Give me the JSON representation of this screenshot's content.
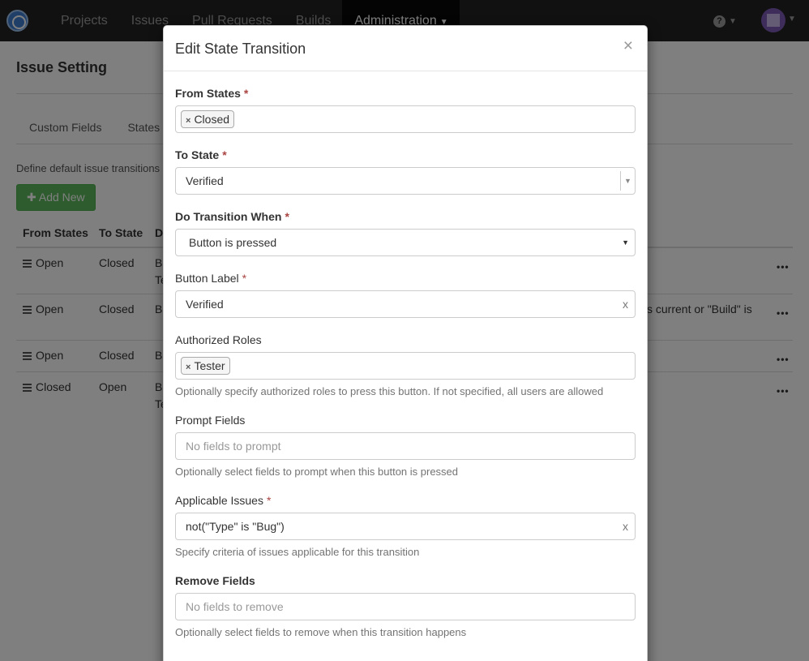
{
  "nav": {
    "items": [
      "Projects",
      "Issues",
      "Pull Requests",
      "Builds",
      "Administration"
    ],
    "active_index": 4
  },
  "page": {
    "title": "Issue Setting",
    "tabs": [
      "Custom Fields",
      "States"
    ],
    "description": "Define default issue transitions",
    "add_button": "Add New",
    "table": {
      "headers": [
        "From States",
        "To State",
        "D"
      ],
      "rows": [
        {
          "from": "Open",
          "to": "Closed",
          "desc": "Bu",
          "desc2": "Te"
        },
        {
          "from": "Open",
          "to": "Closed",
          "desc": "Bu",
          "right": "s current or \"Build\" is"
        },
        {
          "from": "Open",
          "to": "Closed",
          "desc": "Bu"
        },
        {
          "from": "Closed",
          "to": "Open",
          "desc": "Bu",
          "desc2": "Te"
        }
      ],
      "row_menu": "•••"
    }
  },
  "modal": {
    "title": "Edit State Transition",
    "close": "×",
    "from_states": {
      "label": "From States",
      "tags": [
        "Closed"
      ]
    },
    "to_state": {
      "label": "To State",
      "value": "Verified"
    },
    "do_transition_when": {
      "label": "Do Transition When",
      "value": "Button is pressed"
    },
    "button_label": {
      "label": "Button Label",
      "value": "Verified",
      "clear": "x"
    },
    "authorized_roles": {
      "label": "Authorized Roles",
      "tags": [
        "Tester"
      ],
      "help": "Optionally specify authorized roles to press this button. If not specified, all users are allowed"
    },
    "prompt_fields": {
      "label": "Prompt Fields",
      "placeholder": "No fields to prompt",
      "help": "Optionally select fields to prompt when this button is pressed"
    },
    "applicable_issues": {
      "label": "Applicable Issues",
      "value": "not(\"Type\" is \"Bug\")",
      "clear": "x",
      "help": "Specify criteria of issues applicable for this transition"
    },
    "remove_fields": {
      "label": "Remove Fields",
      "placeholder": "No fields to remove",
      "help": "Optionally select fields to remove when this transition happens"
    },
    "required_mark": "*"
  }
}
